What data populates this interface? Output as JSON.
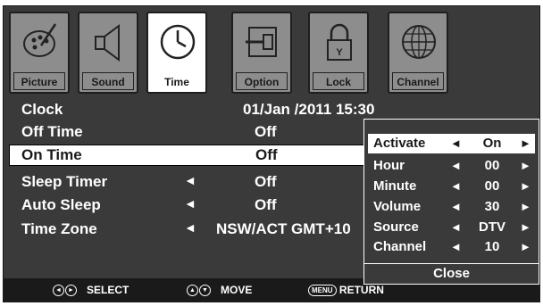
{
  "tabs": [
    {
      "label": "Picture",
      "icon": "picture-icon",
      "active": false
    },
    {
      "label": "Sound",
      "icon": "speaker-icon",
      "active": false
    },
    {
      "label": "Time",
      "icon": "clock-icon",
      "active": true
    },
    {
      "label": "Option",
      "icon": "option-icon",
      "active": false
    },
    {
      "label": "Lock",
      "icon": "lock-icon",
      "active": false
    },
    {
      "label": "Channel",
      "icon": "globe-icon",
      "active": false
    }
  ],
  "settings": {
    "clock": {
      "label": "Clock",
      "value": "01/Jan  /2011 15:30"
    },
    "off_time": {
      "label": "Off Time",
      "value": "Off"
    },
    "on_time": {
      "label": "On Time",
      "value": "Off"
    },
    "sleep_timer": {
      "label": "Sleep Timer",
      "value": "Off"
    },
    "auto_sleep": {
      "label": "Auto Sleep",
      "value": "Off"
    },
    "time_zone": {
      "label": "Time Zone",
      "value": "NSW/ACT GMT+10"
    }
  },
  "arrows": {
    "left": "◄",
    "right": "►"
  },
  "popup": {
    "rows": [
      {
        "label": "Activate",
        "value": "On"
      },
      {
        "label": "Hour",
        "value": "00"
      },
      {
        "label": "Minute",
        "value": "00"
      },
      {
        "label": "Volume",
        "value": "30"
      },
      {
        "label": "Source",
        "value": "DTV"
      },
      {
        "label": "Channel",
        "value": "10"
      }
    ],
    "close_label": "Close"
  },
  "footer": {
    "select_label": "SELECT",
    "move_label": "MOVE",
    "menu_key": "MENU",
    "return_label": "RETURN"
  }
}
